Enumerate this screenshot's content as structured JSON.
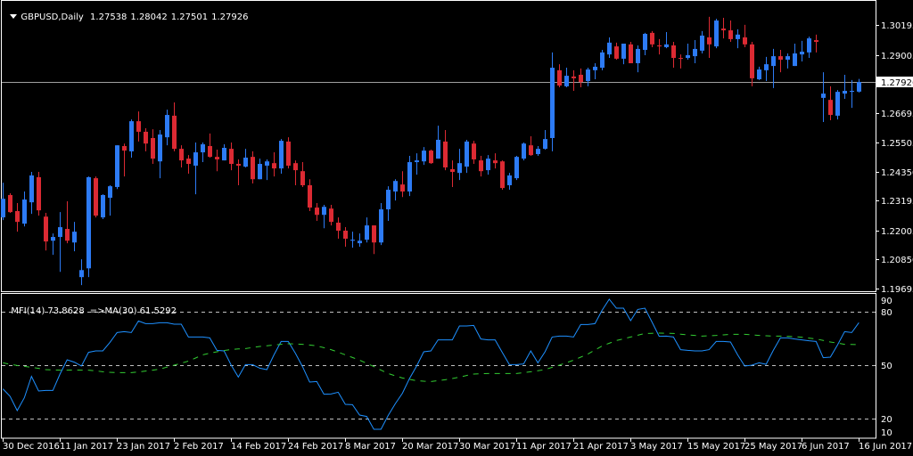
{
  "header": {
    "symbol_timeframe": "GBPUSD,Daily",
    "open": "1.27538",
    "high": "1.28042",
    "low": "1.27501",
    "close": "1.27926",
    "menu_icon": "triangle-down-icon"
  },
  "indicator": {
    "mfi_label": "MFI(14) 73.8628",
    "ma_label": "=>MA(30) 61.5292"
  },
  "colors": {
    "background": "#000000",
    "bull": "#2d7bf5",
    "bear": "#dc2a33",
    "mfi_line": "#1e90ff",
    "ma_line": "#32cd32",
    "grid_level": "#c0c0c0",
    "frame": "#ffffff",
    "current_price_line": "#a0a0a0"
  },
  "chart_data": [
    {
      "type": "candlestick",
      "symbol": "GBPUSD",
      "timeframe": "Daily",
      "ylim": [
        1.19588,
        1.31188
      ],
      "grid": false,
      "current_price": "1.27926",
      "y_tick_labels": [
        "1.30195",
        "1.29005",
        "1.26695",
        "1.25505",
        "1.24350",
        "1.23195",
        "1.22005",
        "1.20850",
        "1.19695"
      ],
      "x_tick_labels": [
        {
          "bar": 0,
          "label": "30 Dec 2016"
        },
        {
          "bar": 8,
          "label": "11 Jan 2017"
        },
        {
          "bar": 16,
          "label": "23 Jan 2017"
        },
        {
          "bar": 24,
          "label": "2 Feb 2017"
        },
        {
          "bar": 32,
          "label": "14 Feb 2017"
        },
        {
          "bar": 40,
          "label": "24 Feb 2017"
        },
        {
          "bar": 48,
          "label": "8 Mar 2017"
        },
        {
          "bar": 56,
          "label": "20 Mar 2017"
        },
        {
          "bar": 64,
          "label": "30 Mar 2017"
        },
        {
          "bar": 72,
          "label": "11 Apr 2017"
        },
        {
          "bar": 80,
          "label": "21 Apr 2017"
        },
        {
          "bar": 88,
          "label": "3 May 2017"
        },
        {
          "bar": 96,
          "label": "15 May 2017"
        },
        {
          "bar": 104,
          "label": "25 May 2017"
        },
        {
          "bar": 112,
          "label": "6 Jun 2017"
        },
        {
          "bar": 120,
          "label": "16 Jun 2017"
        }
      ],
      "open": [
        1.2253,
        1.2342,
        1.2278,
        1.2228,
        1.2313,
        1.2413,
        1.2256,
        1.216,
        1.2175,
        1.2207,
        1.2153,
        1.2015,
        1.205,
        1.2409,
        1.2253,
        1.2331,
        1.2374,
        1.2537,
        1.2516,
        1.2636,
        1.2594,
        1.2569,
        1.2476,
        1.2572,
        1.2658,
        1.2526,
        1.2487,
        1.2459,
        1.2512,
        1.2537,
        1.2494,
        1.248,
        1.2526,
        1.2466,
        1.2455,
        1.2494,
        1.2405,
        1.2459,
        1.2469,
        1.2448,
        1.2555,
        1.2469,
        1.2437,
        1.2381,
        1.2292,
        1.2263,
        1.2288,
        1.2232,
        1.22,
        1.216,
        1.215,
        1.2164,
        1.2221,
        1.2153,
        1.2285,
        1.2356,
        1.2384,
        1.2356,
        1.2473,
        1.2476,
        1.2519,
        1.2487,
        1.2555,
        1.2445,
        1.243,
        1.2455,
        1.2547,
        1.248,
        1.2441,
        1.248,
        1.2476,
        1.2381,
        1.2409,
        1.2487,
        1.254,
        1.2505,
        1.2526,
        1.2569,
        1.2839,
        1.2775,
        1.2814,
        1.2821,
        1.2796,
        1.2839,
        1.2849,
        1.2902,
        1.2934,
        1.2885,
        1.2942,
        1.2867,
        1.292,
        1.2988,
        1.2938,
        1.2931,
        1.2938,
        1.2888,
        1.2888,
        1.2895,
        1.2917,
        1.297,
        1.2934,
        1.3005,
        1.2998,
        1.2963,
        1.297,
        1.2942,
        1.2803,
        1.2839,
        1.2856,
        1.2895,
        1.2881,
        1.2856,
        1.2902,
        1.291,
        1.2959,
        1.2729,
        1.2721,
        1.2658,
        1.2746,
        1.2753,
        1.27538
      ],
      "high": [
        1.2391,
        1.2349,
        1.231,
        1.2356,
        1.2434,
        1.2434,
        1.2271,
        1.2189,
        1.2274,
        1.2317,
        1.2235,
        1.2086,
        1.2416,
        1.2416,
        1.2345,
        1.2381,
        1.254,
        1.2547,
        1.2643,
        1.2675,
        1.2608,
        1.2604,
        1.2601,
        1.2682,
        1.2711,
        1.254,
        1.2501,
        1.2551,
        1.2551,
        1.2587,
        1.2523,
        1.2544,
        1.2551,
        1.2484,
        1.2526,
        1.2516,
        1.2487,
        1.2484,
        1.2512,
        1.2565,
        1.2572,
        1.248,
        1.2473,
        1.2405,
        1.231,
        1.2303,
        1.2303,
        1.2253,
        1.2214,
        1.2196,
        1.2189,
        1.2253,
        1.2221,
        1.231,
        1.2377,
        1.2405,
        1.2437,
        1.2498,
        1.2508,
        1.2533,
        1.2523,
        1.2618,
        1.2601,
        1.248,
        1.2526,
        1.2562,
        1.2558,
        1.2498,
        1.2501,
        1.2508,
        1.248,
        1.243,
        1.2498,
        1.2551,
        1.2576,
        1.2537,
        1.2601,
        1.291,
        1.2863,
        1.2849,
        1.2839,
        1.2846,
        1.2849,
        1.2867,
        1.292,
        1.297,
        1.2949,
        1.2945,
        1.2952,
        1.2938,
        1.2988,
        1.2995,
        1.2963,
        1.2991,
        1.2952,
        1.2902,
        1.2945,
        1.2959,
        1.2995,
        1.3052,
        1.3044,
        1.3048,
        1.3037,
        1.3002,
        1.302,
        1.2952,
        1.2853,
        1.2892,
        1.2924,
        1.292,
        1.2906,
        1.2945,
        1.2956,
        1.2973,
        1.2981,
        1.2831,
        1.2775,
        1.276,
        1.2821,
        1.28,
        1.28042
      ],
      "low": [
        1.2242,
        1.2271,
        1.2196,
        1.2217,
        1.2267,
        1.226,
        1.2121,
        1.2104,
        1.2036,
        1.215,
        1.2118,
        1.1983,
        1.2015,
        1.2253,
        1.2246,
        1.226,
        1.2366,
        1.2416,
        1.2491,
        1.2555,
        1.2516,
        1.2466,
        1.2409,
        1.254,
        1.2516,
        1.2452,
        1.2427,
        1.2345,
        1.2473,
        1.2491,
        1.2437,
        1.248,
        1.2441,
        1.2381,
        1.2452,
        1.2388,
        1.2405,
        1.2402,
        1.2416,
        1.2427,
        1.2448,
        1.2381,
        1.2374,
        1.2278,
        1.2239,
        1.221,
        1.2221,
        1.2168,
        1.2136,
        1.2132,
        1.2136,
        1.2153,
        1.2107,
        1.2143,
        1.2239,
        1.232,
        1.2334,
        1.2338,
        1.2423,
        1.2462,
        1.2466,
        1.2487,
        1.2441,
        1.2374,
        1.2402,
        1.243,
        1.2466,
        1.2416,
        1.2423,
        1.2448,
        1.2363,
        1.2363,
        1.2402,
        1.248,
        1.2498,
        1.2498,
        1.2523,
        1.2516,
        1.2771,
        1.2771,
        1.2757,
        1.2771,
        1.2775,
        1.2803,
        1.2839,
        1.2888,
        1.2881,
        1.2863,
        1.2867,
        1.2831,
        1.2899,
        1.2931,
        1.2902,
        1.2927,
        1.2849,
        1.2846,
        1.2881,
        1.2867,
        1.2906,
        1.2888,
        1.2927,
        1.2966,
        1.2952,
        1.2927,
        1.2931,
        1.2775,
        1.28,
        1.2796,
        1.2768,
        1.2831,
        1.2846,
        1.2856,
        1.2874,
        1.2888,
        1.291,
        1.2633,
        1.264,
        1.2643,
        1.2725,
        1.2689,
        1.27501
      ],
      "close": [
        1.2327,
        1.2274,
        1.2235,
        1.2324,
        1.242,
        1.2281,
        1.2157,
        1.2175,
        1.2214,
        1.216,
        1.2196,
        1.2043,
        1.2413,
        1.226,
        1.2342,
        1.2377,
        1.254,
        1.2519,
        1.2636,
        1.2594,
        1.2547,
        1.2487,
        1.2583,
        1.2661,
        1.2526,
        1.248,
        1.2466,
        1.2512,
        1.2544,
        1.2494,
        1.2484,
        1.253,
        1.2466,
        1.2459,
        1.2491,
        1.2405,
        1.2466,
        1.2476,
        1.2448,
        1.2558,
        1.2459,
        1.2441,
        1.2381,
        1.2292,
        1.2263,
        1.2295,
        1.2235,
        1.22,
        1.2168,
        1.2164,
        1.216,
        1.2221,
        1.2153,
        1.2285,
        1.2363,
        1.2398,
        1.2356,
        1.2473,
        1.248,
        1.2519,
        1.2469,
        1.2562,
        1.2452,
        1.2434,
        1.2469,
        1.2555,
        1.2484,
        1.2437,
        1.2487,
        1.2469,
        1.237,
        1.242,
        1.2494,
        1.2547,
        1.2501,
        1.2526,
        1.2565,
        1.2849,
        1.2778,
        1.2817,
        1.2807,
        1.2792,
        1.2842,
        1.2853,
        1.291,
        1.2949,
        1.2885,
        1.2945,
        1.2867,
        1.2924,
        1.2984,
        1.2942,
        1.2934,
        1.2942,
        1.2888,
        1.2885,
        1.2899,
        1.2924,
        1.2977,
        1.2942,
        1.3037,
        1.2998,
        1.2963,
        1.2981,
        1.2942,
        1.2807,
        1.2842,
        1.2863,
        1.2895,
        1.2881,
        1.2895,
        1.2906,
        1.2913,
        1.2966,
        1.2952,
        1.2746,
        1.2661,
        1.2753,
        1.2757,
        1.2757,
        1.27926
      ]
    },
    {
      "type": "line",
      "ylim": [
        9,
        90
      ],
      "y_tick_labels": [
        "90",
        "80",
        "50",
        "20",
        "10"
      ],
      "levels": [
        80,
        50,
        20
      ],
      "series": [
        {
          "name": "MFI(14)",
          "style": "solid",
          "values": [
            36.7,
            32.5,
            24.5,
            31.7,
            43.7,
            35.5,
            35.8,
            35.8,
            45,
            53,
            51.7,
            49.5,
            57.2,
            58,
            58,
            62.8,
            68.3,
            68.8,
            68.3,
            74.8,
            73.3,
            73.3,
            73.8,
            73.8,
            73,
            73,
            65.8,
            65.8,
            65.8,
            65.3,
            58.3,
            58,
            50,
            43.3,
            50.3,
            50.3,
            48.3,
            47.5,
            55.8,
            63.3,
            63.3,
            56.7,
            49.2,
            40.5,
            40.8,
            33.7,
            33.8,
            34.8,
            28,
            27.8,
            22,
            21.2,
            14,
            14,
            21.7,
            28.3,
            34.2,
            42.5,
            49.5,
            57.5,
            58,
            64.2,
            64.2,
            64.2,
            72,
            72,
            72.3,
            64.7,
            64.2,
            64.2,
            57.2,
            50.3,
            50.3,
            50.7,
            58,
            51.3,
            57.5,
            65.8,
            66.3,
            66.3,
            65.8,
            72.8,
            72.8,
            73.3,
            80.8,
            87,
            82,
            82,
            75,
            81.3,
            82,
            74.2,
            66.2,
            66.3,
            65.8,
            58.7,
            58.3,
            58,
            58,
            58.7,
            63.3,
            63.3,
            63,
            55.8,
            49.5,
            50,
            51.3,
            50.5,
            58.3,
            65.3,
            65.3,
            64.7,
            64.2,
            63.7,
            63.3,
            54.2,
            54.5,
            61.3,
            68.8,
            68.3,
            73.8628
          ]
        },
        {
          "name": "MA(30)",
          "style": "dashed",
          "values": [
            51.3,
            50.5,
            49.8,
            49.3,
            48.8,
            48.2,
            47.5,
            47.3,
            47.2,
            47.2,
            47.3,
            47.2,
            47.2,
            46.8,
            46.3,
            46.0,
            45.8,
            45.8,
            45.8,
            46.2,
            46.7,
            47.2,
            47.8,
            48.9,
            50,
            51.1,
            52.3,
            54,
            55.8,
            56.7,
            57.5,
            58.2,
            58.8,
            59.1,
            59.3,
            59.9,
            60.5,
            60.9,
            61.3,
            61.7,
            62,
            61.9,
            61.7,
            61.3,
            60.8,
            59.8,
            58.7,
            57.3,
            55.8,
            54.3,
            52.8,
            51,
            49.2,
            47.2,
            45.3,
            44,
            42.8,
            42,
            41.3,
            41,
            40.8,
            41.3,
            41.8,
            42.5,
            43.3,
            44.2,
            45,
            45.2,
            45.3,
            45.3,
            45.3,
            45.3,
            45.3,
            45.8,
            46.3,
            46.9,
            47.5,
            48.8,
            50,
            51.4,
            52.8,
            54.5,
            56.2,
            58.5,
            60.8,
            62.3,
            63.8,
            64.8,
            65.8,
            66.8,
            67.8,
            67.9,
            68,
            67.9,
            67.8,
            67.4,
            67,
            66.7,
            66.3,
            66.5,
            66.7,
            67,
            67.3,
            67.3,
            67.3,
            67,
            66.7,
            66.5,
            66.3,
            66.3,
            66.2,
            66,
            65.7,
            65.2,
            64.7,
            63.9,
            63,
            62.4,
            61.7,
            61.6,
            61.5292
          ]
        }
      ]
    }
  ]
}
